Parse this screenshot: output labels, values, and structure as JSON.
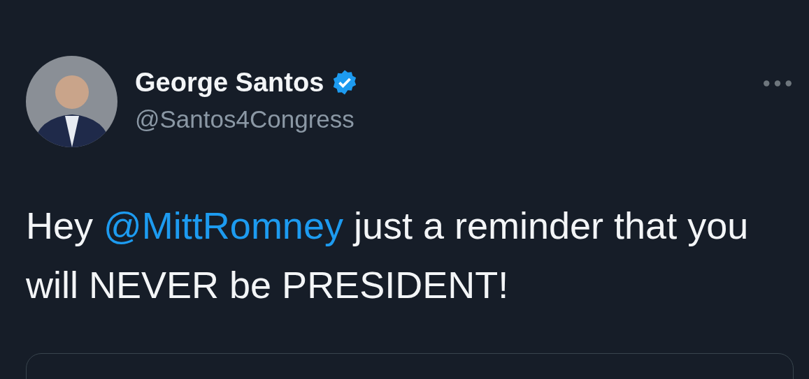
{
  "author": {
    "name": "George Santos",
    "verified": true,
    "handle": "@Santos4Congress"
  },
  "tweet": {
    "segments": [
      {
        "kind": "text",
        "text": "Hey "
      },
      {
        "kind": "mention",
        "text": "@MittRomney"
      },
      {
        "kind": "text",
        "text": " just a reminder that you will NEVER be PRESIDENT!"
      }
    ]
  }
}
